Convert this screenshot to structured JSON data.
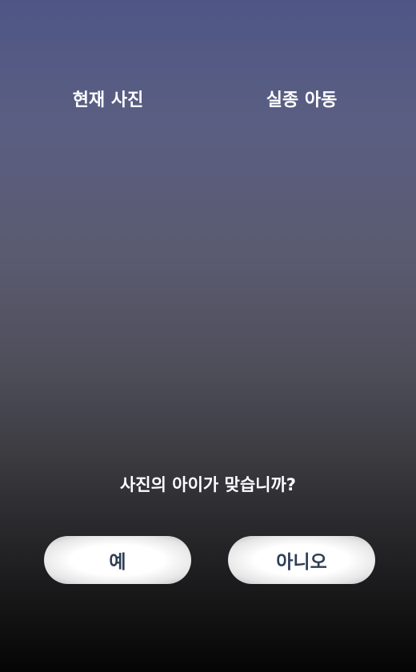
{
  "labels": {
    "current_photo": "현재 사진",
    "missing_child": "실종 아동"
  },
  "question": "사진의 아이가 맞습니까?",
  "buttons": {
    "yes": "예",
    "no": "아니오"
  },
  "colors": {
    "button_text": "#2f3e56",
    "background_top": "#4f5686",
    "background_bottom": "#050505"
  }
}
